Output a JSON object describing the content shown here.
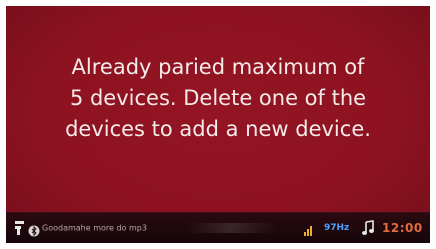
{
  "dialog": {
    "message_lines": [
      "Already paried maximum of",
      "5 devices. Delete one of the",
      "devices to add a new device."
    ]
  },
  "status_bar": {
    "source_icon": "media-source-icon",
    "bluetooth_icon": "bluetooth-icon",
    "track_text": "Goodamahe more do mp3",
    "small_icon": "signal-icon",
    "frequency": "97Hz",
    "user_icon": "music-note-icon",
    "clock": "12:00"
  },
  "colors": {
    "background": "#8d1220",
    "status_bar": "#1a070c",
    "text": "#f4eaea",
    "frequency": "#4fa0ff",
    "clock": "#e06a3c"
  }
}
